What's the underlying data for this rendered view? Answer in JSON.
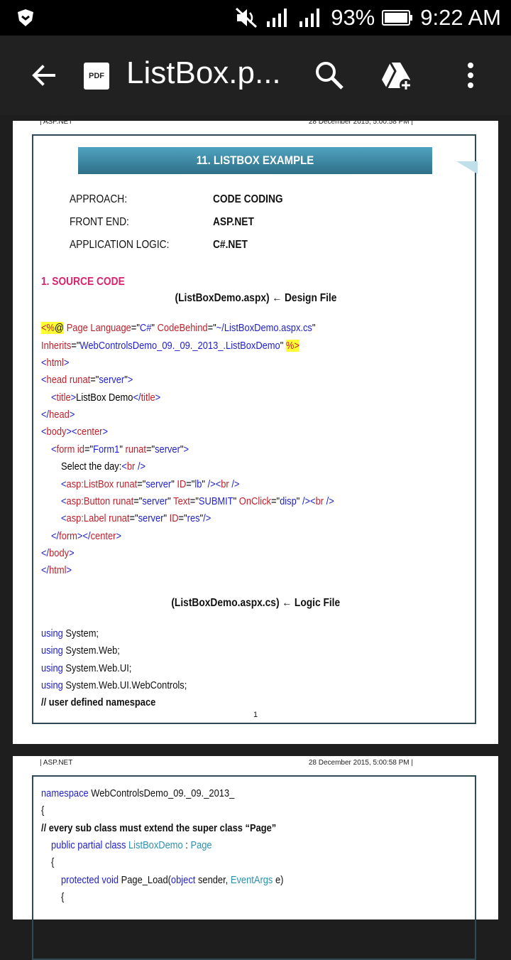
{
  "status_bar": {
    "battery": "93%",
    "time": "9:22 AM"
  },
  "app_bar": {
    "title": "ListBox.p...",
    "file_badge": "PDF"
  },
  "page1": {
    "header_left": "| ASP.NET",
    "header_right": "28 December 2015, 5:00:58 PM |",
    "banner": "11. LISTBOX EXAMPLE",
    "meta": [
      {
        "label": "APPROACH:",
        "value": "CODE CODING"
      },
      {
        "label": "FRONT END:",
        "value": "ASP.NET"
      },
      {
        "label": "APPLICATION LOGIC:",
        "value": "C#.NET"
      }
    ],
    "section": "1. SOURCE CODE",
    "design_caption": "(ListBoxDemo.aspx) ← Design File",
    "logic_caption": "(ListBoxDemo.aspx.cs) ← Logic File",
    "page_number": "1",
    "using": [
      "using",
      "System;",
      "System.Web;",
      "System.Web.UI;",
      "System.Web.UI.WebControls;"
    ],
    "comment": "// user defined namespace"
  },
  "page2": {
    "header_left": "| ASP.NET",
    "header_right": "28 December 2015, 5:00:58 PM |",
    "ns_kw": "namespace",
    "ns_name": "WebControlsDemo_09._09._2013_",
    "brace_open": "{",
    "comment": "// every sub class must extend the super class “Page”",
    "class_kw": "public partial class",
    "class_name": "ListBoxDemo",
    "colon": ":",
    "base": "Page",
    "brace2": "{",
    "method_kw": "protected void",
    "method": "Page_Load(",
    "obj": "object",
    "sender": "sender,",
    "evt": "EventArgs",
    "e": "e)",
    "brace3": "{"
  }
}
